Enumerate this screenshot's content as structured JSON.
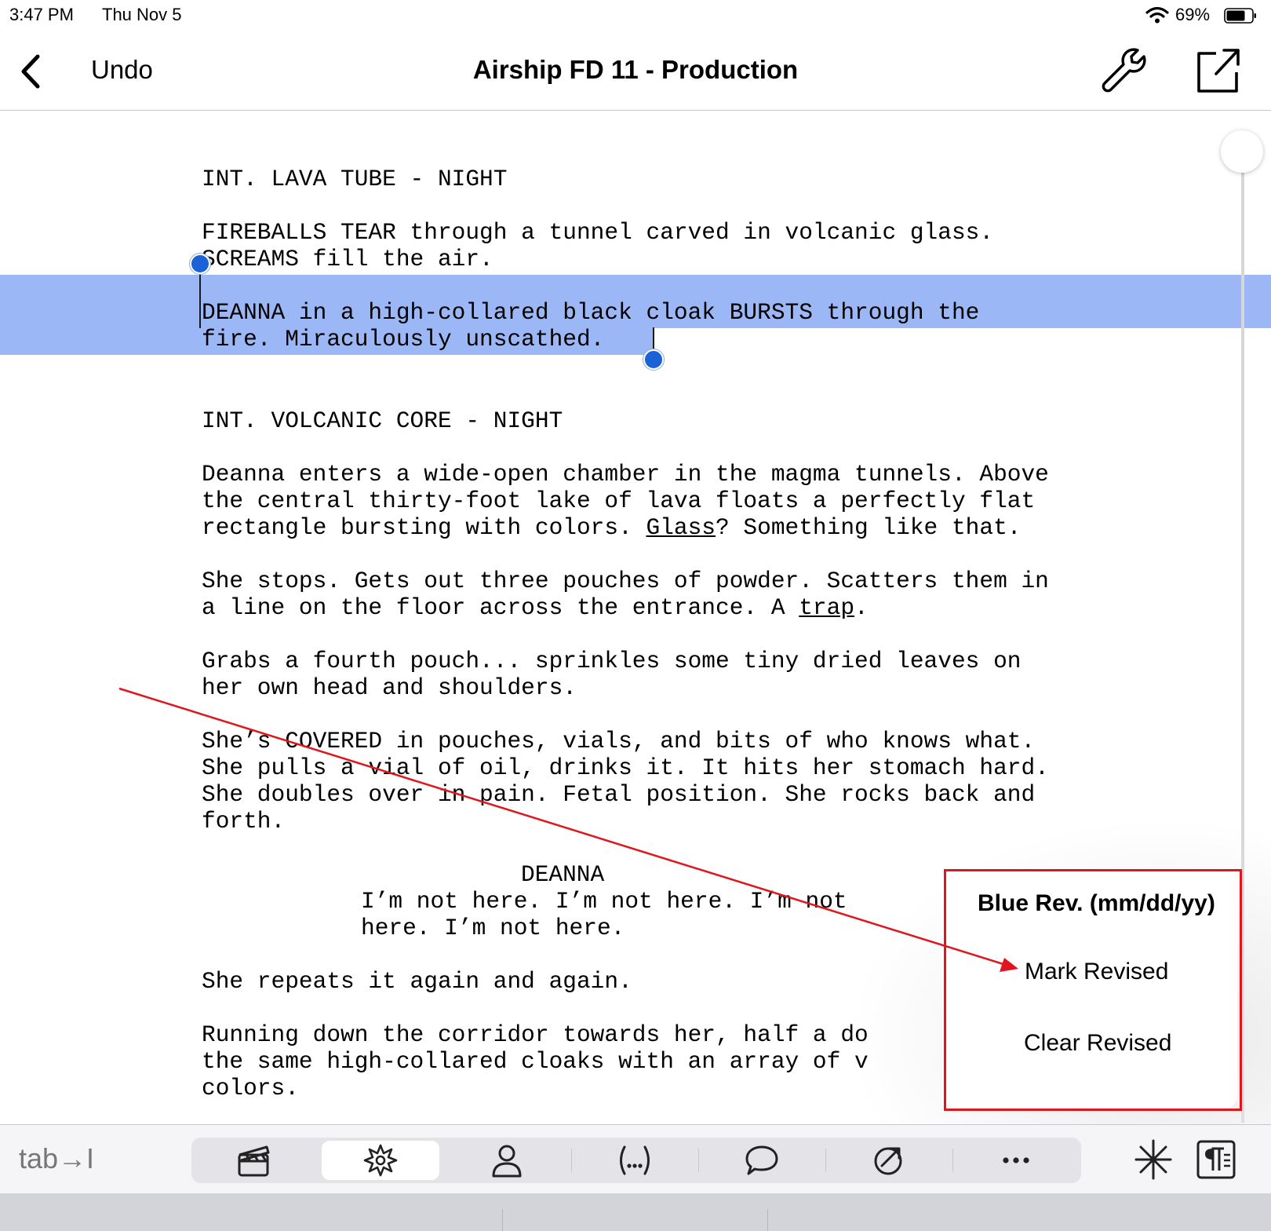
{
  "status": {
    "time": "3:47 PM",
    "date": "Thu Nov 5",
    "battery": "69%"
  },
  "nav": {
    "undo": "Undo",
    "title": "Airship FD 11 - Production"
  },
  "script": {
    "lines": [
      "INT. LAVA TUBE - NIGHT",
      "FIREBALLS TEAR through a tunnel carved in volcanic glass.",
      "SCREAMS fill the air.",
      "DEANNA in a high-collared black cloak BURSTS through the",
      "fire. Miraculously unscathed.",
      "INT. VOLCANIC CORE - NIGHT",
      "Deanna enters a wide-open chamber in the magma tunnels. Above",
      "the central thirty-foot lake of lava floats a perfectly flat",
      "She stops. Gets out three pouches of powder. Scatters them in",
      "Grabs a fourth pouch... sprinkles some tiny dried leaves on",
      "her own head and shoulders.",
      "She’s COVERED in pouches, vials, and bits of who knows what.",
      "She pulls a vial of oil, drinks it. It hits her stomach hard.",
      "She doubles over in pain. Fetal position. She rocks back and",
      "forth.",
      "DEANNA",
      "I’m not here. I’m not here. I’m not",
      "here. I’m not here.",
      "She repeats it again and again.",
      "Running down the corridor towards her, half a do",
      "the same high-collared cloaks with an array of v",
      "colors."
    ],
    "rect_pre": "rectangle bursting with colors. ",
    "rect_u": "Glass",
    "rect_post": "? Something like that.",
    "trap_pre": "a line on the floor across the entrance. A ",
    "trap_u": "trap",
    "trap_post": "."
  },
  "popover": {
    "title": "Blue Rev. (mm/dd/yy)",
    "items": [
      "Mark Revised",
      "Clear Revised"
    ]
  },
  "toolbar": {
    "tab_label": "tab→I"
  },
  "colors": {
    "selection": "#9cb7f5",
    "handle": "#1a62d6",
    "annotation": "#e0161e"
  },
  "icons": [
    "chevron-left-icon",
    "wrench-icon",
    "share-icon",
    "clapperboard-icon",
    "action-icon",
    "character-icon",
    "parenthetical-icon",
    "dialogue-bubble-icon",
    "transition-icon",
    "more-icon",
    "asterisk-icon",
    "paragraph-format-icon"
  ]
}
